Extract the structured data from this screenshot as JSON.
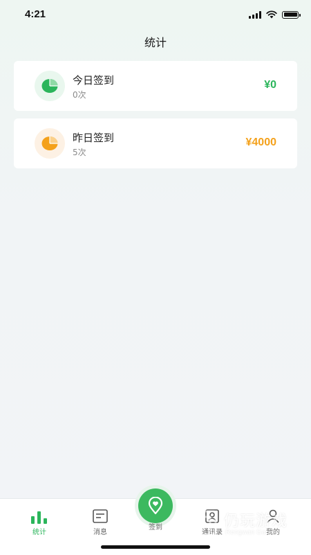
{
  "status_bar": {
    "time": "4:21"
  },
  "header": {
    "title": "统计"
  },
  "cards": [
    {
      "title": "今日签到",
      "count": "0次",
      "amount": "¥0",
      "icon": "pie-chart-icon",
      "accent": "#2bb55b"
    },
    {
      "title": "昨日签到",
      "count": "5次",
      "amount": "¥4000",
      "icon": "pie-chart-icon",
      "accent": "#f4a11b"
    }
  ],
  "tab_bar": {
    "active": "统计",
    "tabs": [
      {
        "label": "统计",
        "icon": "bar-chart-icon"
      },
      {
        "label": "消息",
        "icon": "message-icon"
      },
      {
        "label": "签到",
        "icon": "location-pin-icon"
      },
      {
        "label": "通讯录",
        "icon": "contacts-icon"
      },
      {
        "label": "我的",
        "icon": "person-icon"
      }
    ]
  },
  "watermark": {
    "text": "仍玩游戏",
    "subtext": "Rengwan Games"
  },
  "colors": {
    "brand_green": "#3cb95f",
    "amount_green": "#2bb55b",
    "amount_orange": "#f4a11b"
  }
}
